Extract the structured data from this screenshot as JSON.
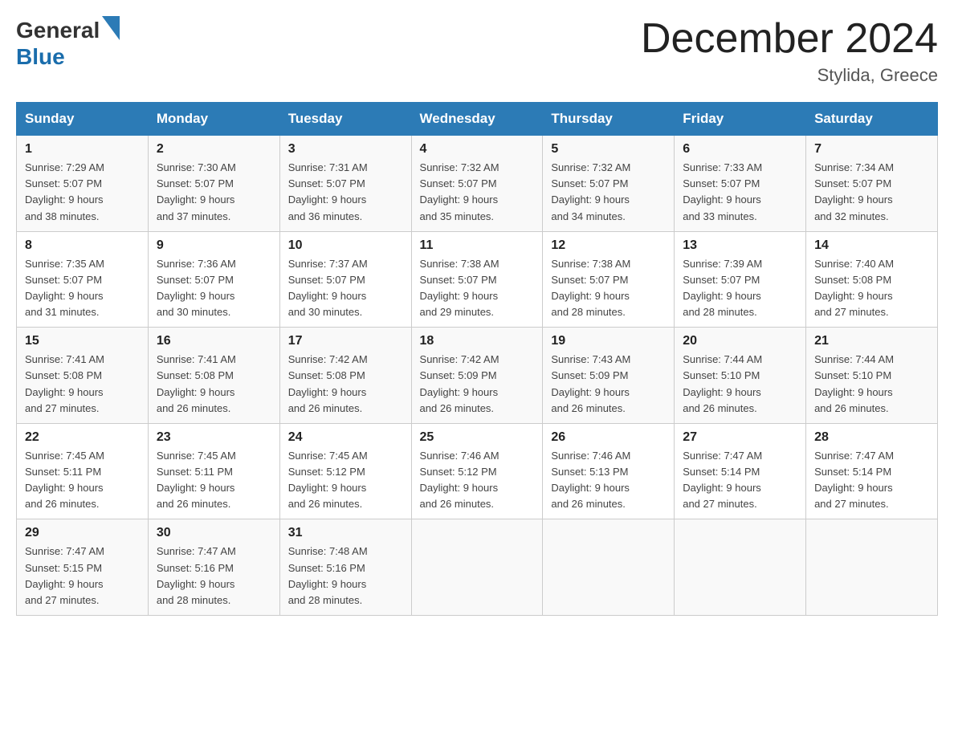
{
  "header": {
    "logo": {
      "text_general": "General",
      "text_blue": "Blue"
    },
    "title": "December 2024",
    "location": "Stylida, Greece"
  },
  "days_of_week": [
    "Sunday",
    "Monday",
    "Tuesday",
    "Wednesday",
    "Thursday",
    "Friday",
    "Saturday"
  ],
  "weeks": [
    [
      {
        "day": "1",
        "sunrise": "7:29 AM",
        "sunset": "5:07 PM",
        "daylight": "9 hours and 38 minutes."
      },
      {
        "day": "2",
        "sunrise": "7:30 AM",
        "sunset": "5:07 PM",
        "daylight": "9 hours and 37 minutes."
      },
      {
        "day": "3",
        "sunrise": "7:31 AM",
        "sunset": "5:07 PM",
        "daylight": "9 hours and 36 minutes."
      },
      {
        "day": "4",
        "sunrise": "7:32 AM",
        "sunset": "5:07 PM",
        "daylight": "9 hours and 35 minutes."
      },
      {
        "day": "5",
        "sunrise": "7:32 AM",
        "sunset": "5:07 PM",
        "daylight": "9 hours and 34 minutes."
      },
      {
        "day": "6",
        "sunrise": "7:33 AM",
        "sunset": "5:07 PM",
        "daylight": "9 hours and 33 minutes."
      },
      {
        "day": "7",
        "sunrise": "7:34 AM",
        "sunset": "5:07 PM",
        "daylight": "9 hours and 32 minutes."
      }
    ],
    [
      {
        "day": "8",
        "sunrise": "7:35 AM",
        "sunset": "5:07 PM",
        "daylight": "9 hours and 31 minutes."
      },
      {
        "day": "9",
        "sunrise": "7:36 AM",
        "sunset": "5:07 PM",
        "daylight": "9 hours and 30 minutes."
      },
      {
        "day": "10",
        "sunrise": "7:37 AM",
        "sunset": "5:07 PM",
        "daylight": "9 hours and 30 minutes."
      },
      {
        "day": "11",
        "sunrise": "7:38 AM",
        "sunset": "5:07 PM",
        "daylight": "9 hours and 29 minutes."
      },
      {
        "day": "12",
        "sunrise": "7:38 AM",
        "sunset": "5:07 PM",
        "daylight": "9 hours and 28 minutes."
      },
      {
        "day": "13",
        "sunrise": "7:39 AM",
        "sunset": "5:07 PM",
        "daylight": "9 hours and 28 minutes."
      },
      {
        "day": "14",
        "sunrise": "7:40 AM",
        "sunset": "5:08 PM",
        "daylight": "9 hours and 27 minutes."
      }
    ],
    [
      {
        "day": "15",
        "sunrise": "7:41 AM",
        "sunset": "5:08 PM",
        "daylight": "9 hours and 27 minutes."
      },
      {
        "day": "16",
        "sunrise": "7:41 AM",
        "sunset": "5:08 PM",
        "daylight": "9 hours and 26 minutes."
      },
      {
        "day": "17",
        "sunrise": "7:42 AM",
        "sunset": "5:08 PM",
        "daylight": "9 hours and 26 minutes."
      },
      {
        "day": "18",
        "sunrise": "7:42 AM",
        "sunset": "5:09 PM",
        "daylight": "9 hours and 26 minutes."
      },
      {
        "day": "19",
        "sunrise": "7:43 AM",
        "sunset": "5:09 PM",
        "daylight": "9 hours and 26 minutes."
      },
      {
        "day": "20",
        "sunrise": "7:44 AM",
        "sunset": "5:10 PM",
        "daylight": "9 hours and 26 minutes."
      },
      {
        "day": "21",
        "sunrise": "7:44 AM",
        "sunset": "5:10 PM",
        "daylight": "9 hours and 26 minutes."
      }
    ],
    [
      {
        "day": "22",
        "sunrise": "7:45 AM",
        "sunset": "5:11 PM",
        "daylight": "9 hours and 26 minutes."
      },
      {
        "day": "23",
        "sunrise": "7:45 AM",
        "sunset": "5:11 PM",
        "daylight": "9 hours and 26 minutes."
      },
      {
        "day": "24",
        "sunrise": "7:45 AM",
        "sunset": "5:12 PM",
        "daylight": "9 hours and 26 minutes."
      },
      {
        "day": "25",
        "sunrise": "7:46 AM",
        "sunset": "5:12 PM",
        "daylight": "9 hours and 26 minutes."
      },
      {
        "day": "26",
        "sunrise": "7:46 AM",
        "sunset": "5:13 PM",
        "daylight": "9 hours and 26 minutes."
      },
      {
        "day": "27",
        "sunrise": "7:47 AM",
        "sunset": "5:14 PM",
        "daylight": "9 hours and 27 minutes."
      },
      {
        "day": "28",
        "sunrise": "7:47 AM",
        "sunset": "5:14 PM",
        "daylight": "9 hours and 27 minutes."
      }
    ],
    [
      {
        "day": "29",
        "sunrise": "7:47 AM",
        "sunset": "5:15 PM",
        "daylight": "9 hours and 27 minutes."
      },
      {
        "day": "30",
        "sunrise": "7:47 AM",
        "sunset": "5:16 PM",
        "daylight": "9 hours and 28 minutes."
      },
      {
        "day": "31",
        "sunrise": "7:48 AM",
        "sunset": "5:16 PM",
        "daylight": "9 hours and 28 minutes."
      },
      null,
      null,
      null,
      null
    ]
  ],
  "labels": {
    "sunrise": "Sunrise:",
    "sunset": "Sunset:",
    "daylight": "Daylight:"
  }
}
